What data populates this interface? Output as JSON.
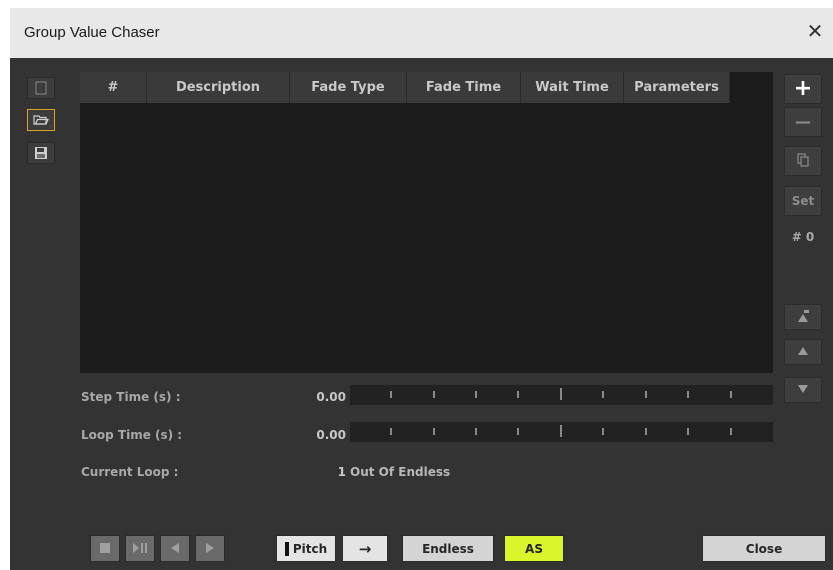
{
  "window": {
    "title": "Group Value Chaser",
    "close_glyph": "✕"
  },
  "left_toolbar": {
    "icons": [
      "new-file-icon",
      "open-folder-icon",
      "save-icon"
    ]
  },
  "table": {
    "columns": [
      "#",
      "Description",
      "Fade Type",
      "Fade Time",
      "Wait Time",
      "Parameters"
    ],
    "rows": []
  },
  "right_toolbar": {
    "add_glyph": "+",
    "remove_glyph": "—",
    "copy_icon": "copy-icon",
    "set_label": "Set",
    "count_label": "# 0",
    "icons": [
      "move-to-top-icon",
      "move-up-icon",
      "move-down-icon"
    ]
  },
  "params": {
    "step_time": {
      "label": "Step Time (s) :",
      "value": "0.00"
    },
    "loop_time": {
      "label": "Loop Time (s) :",
      "value": "0.00"
    },
    "current_loop": {
      "label": "Current Loop :",
      "value": "1",
      "suffix": "Out Of Endless"
    }
  },
  "transport": {
    "icons": [
      "stop-icon",
      "play-pause-icon",
      "previous-icon",
      "next-icon"
    ]
  },
  "buttons": {
    "pitch": "Pitch",
    "direction_glyph": "→",
    "endless": "Endless",
    "as": "AS",
    "close": "Close"
  },
  "colors": {
    "dialog_bg": "#333333",
    "table_bg": "#1c1c1c",
    "as_active": "#d9f52b",
    "selected_border": "#d8a42a"
  }
}
